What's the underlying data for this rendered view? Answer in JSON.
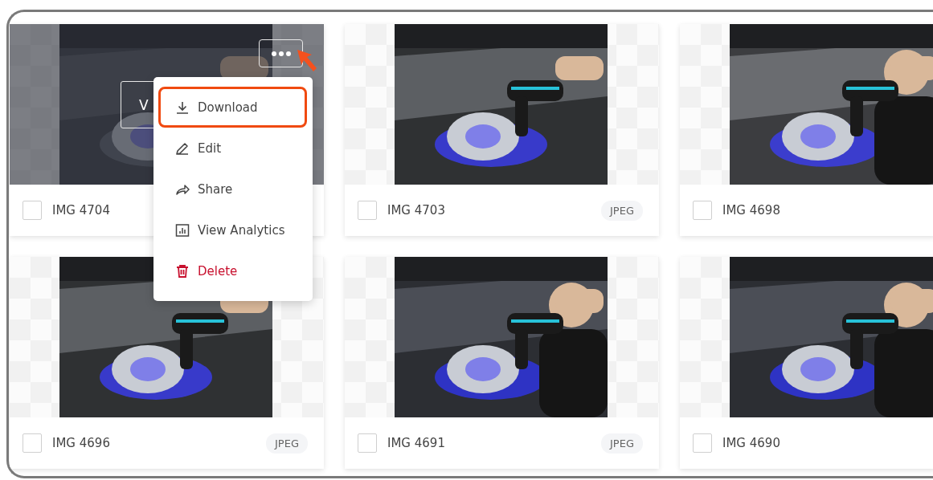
{
  "cards": [
    {
      "name": "IMG 4704",
      "checked": false,
      "hovered": true,
      "view_button": "V"
    },
    {
      "name": "IMG 4703",
      "format": "JPEG",
      "checked": false,
      "hovered": false
    },
    {
      "name": "IMG 4698",
      "checked": false,
      "hovered": false
    },
    {
      "name": "IMG 4696",
      "format": "JPEG",
      "checked": false,
      "hovered": false
    },
    {
      "name": "IMG 4691",
      "format": "JPEG",
      "checked": false,
      "hovered": false
    },
    {
      "name": "IMG 4690",
      "checked": false,
      "hovered": false
    }
  ],
  "menu": {
    "items": [
      {
        "label": "Download",
        "kind": "download",
        "highlighted": true
      },
      {
        "label": "Edit",
        "kind": "edit",
        "highlighted": false
      },
      {
        "label": "Share",
        "kind": "share",
        "highlighted": false
      },
      {
        "label": "View Analytics",
        "kind": "analytics",
        "highlighted": false
      },
      {
        "label": "Delete",
        "kind": "delete",
        "highlighted": false
      }
    ]
  }
}
